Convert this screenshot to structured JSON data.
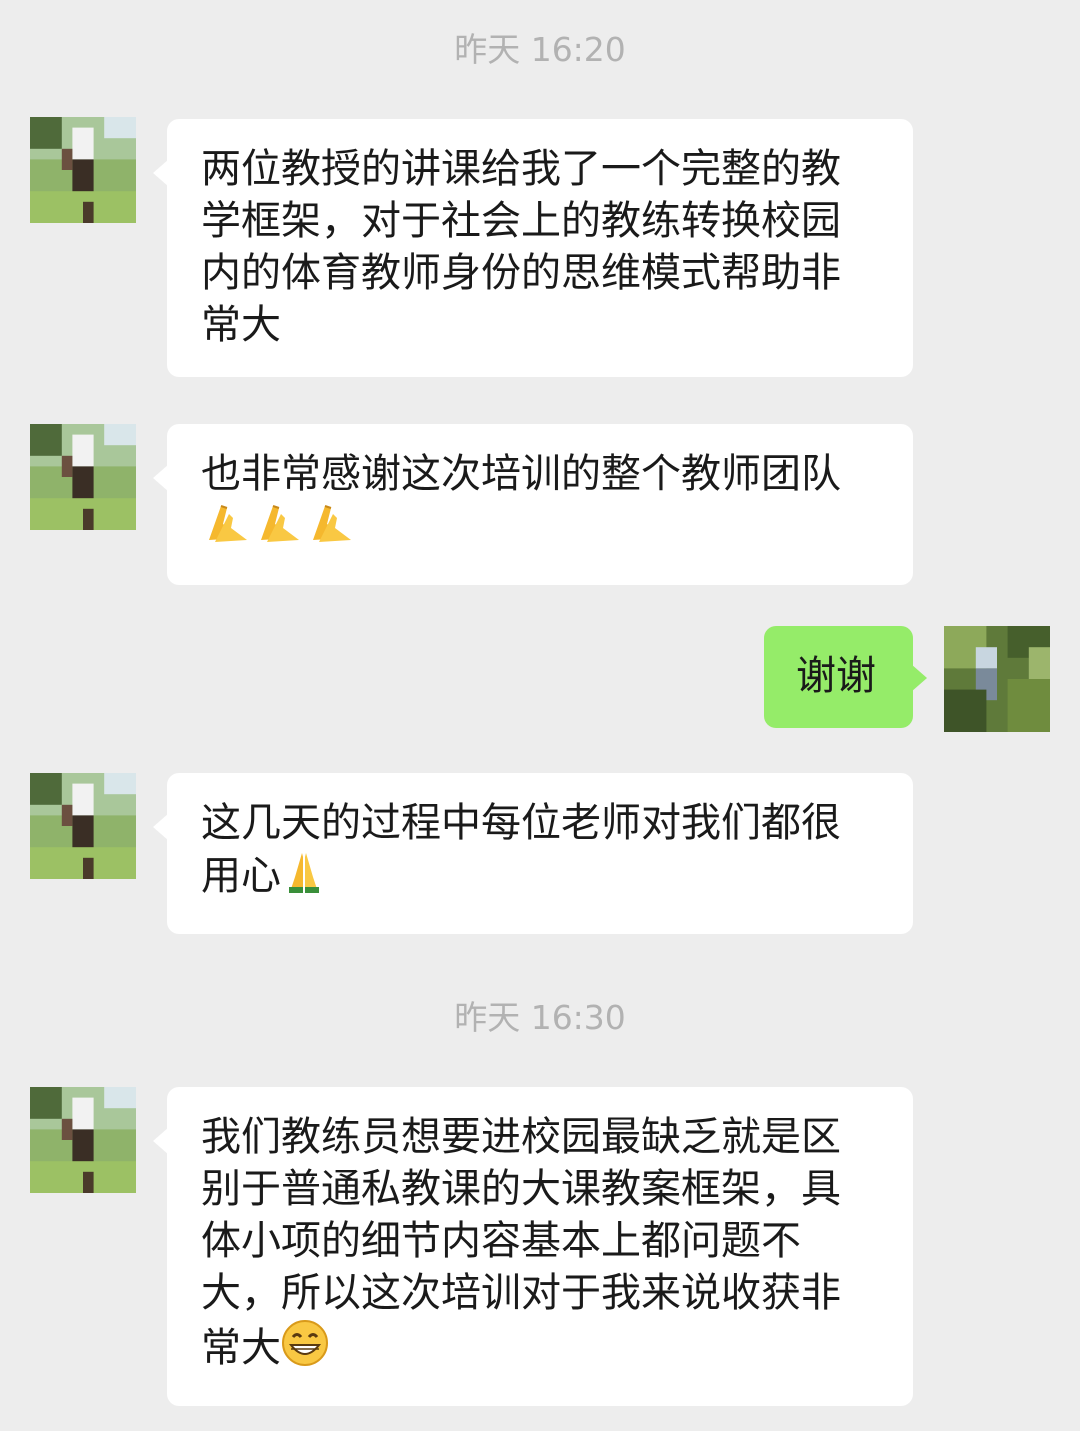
{
  "messages": [
    {
      "type": "timestamp",
      "text": "昨天 16:20"
    },
    {
      "type": "in",
      "text": "两位教授的讲课给我了一个完整的教学框架，对于社会上的教练转换校园内的体育教师身份的思维模式帮助非常大"
    },
    {
      "type": "in",
      "text": "也非常感谢这次培训的整个教师团队",
      "emojis": [
        "clap-hands-emoji",
        "clap-hands-emoji",
        "clap-hands-emoji"
      ]
    },
    {
      "type": "out",
      "text": "谢谢"
    },
    {
      "type": "in",
      "text": "这几天的过程中每位老师对我们都很用心",
      "emojis": [
        "pray-hands-emoji"
      ]
    },
    {
      "type": "timestamp",
      "text": "昨天 16:30"
    },
    {
      "type": "in",
      "text": "我们教练员想要进校园最缺乏就是区别于普通私教课的大课教案框架，具体小项的细节内容基本上都问题不大，所以这次培训对于我来说收获非常大",
      "emojis": [
        "grinning-face-emoji"
      ]
    }
  ],
  "colors": {
    "background": "#ededed",
    "incoming_bubble": "#ffffff",
    "outgoing_bubble": "#95ec69",
    "timestamp_text": "#b2b2b2"
  }
}
